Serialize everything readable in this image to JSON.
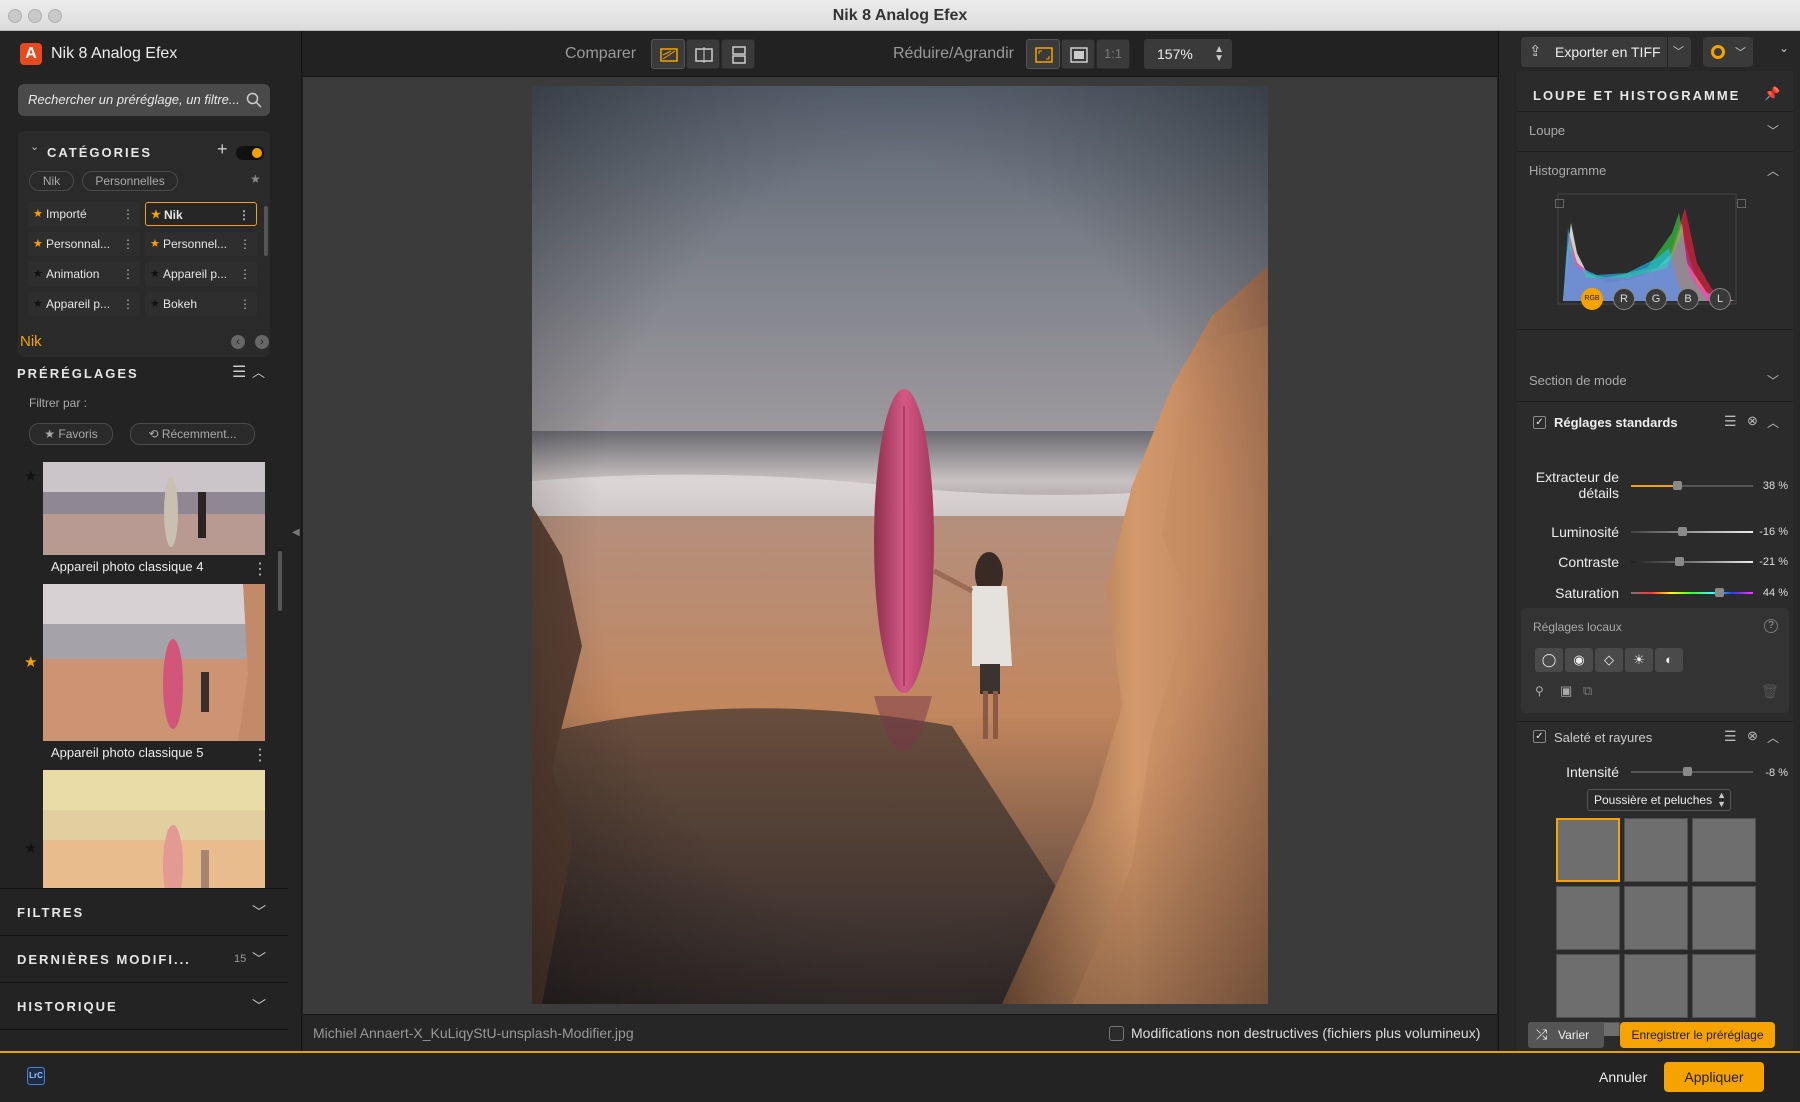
{
  "window": {
    "title": "Nik 8 Analog Efex"
  },
  "left": {
    "app_name": "Nik 8 Analog Efex",
    "app_logo_letter": "A",
    "search_placeholder": "Rechercher un préréglage, un filtre...",
    "categories": {
      "title": "CATÉGORIES",
      "filters": [
        "Nik",
        "Personnelles"
      ],
      "items": [
        {
          "label": "Importé",
          "starred": true,
          "selected": false
        },
        {
          "label": "Nik",
          "starred": true,
          "selected": true
        },
        {
          "label": "Personnal...",
          "starred": true,
          "selected": false
        },
        {
          "label": "Personnel...",
          "starred": true,
          "selected": false
        },
        {
          "label": "Animation",
          "starred": false,
          "selected": false
        },
        {
          "label": "Appareil p...",
          "starred": false,
          "selected": false
        },
        {
          "label": "Appareil p...",
          "starred": false,
          "selected": false
        },
        {
          "label": "Bokeh",
          "starred": false,
          "selected": false
        }
      ]
    },
    "collection_label": "Nik",
    "presets": {
      "title": "PRÉRÉGLAGES",
      "filter_by": "Filtrer par :",
      "filter_favs": "Favoris",
      "filter_recent": "Récemment...",
      "items": [
        {
          "label": "Appareil photo classique 4",
          "favorite": false
        },
        {
          "label": "Appareil photo classique 5",
          "favorite": true
        },
        {
          "label": "",
          "favorite": false
        }
      ]
    },
    "sections": [
      {
        "title": "FILTRES",
        "count": ""
      },
      {
        "title": "DERNIÈRES MODIFI...",
        "count": "15"
      },
      {
        "title": "HISTORIQUE",
        "count": ""
      }
    ]
  },
  "toolbar": {
    "compare_label": "Comparer",
    "zoom_label": "Réduire/Agrandir",
    "one_to_one": "1:1",
    "zoom_value": "157%"
  },
  "status": {
    "filename": "Michiel Annaert-X_KuLiqyStU-unsplash-Modifier.jpg",
    "nondestructive": "Modifications non destructives (fichiers plus volumineux)"
  },
  "right": {
    "export_label": "Exporter en TIFF",
    "loupe_hist_title": "LOUPE ET HISTOGRAMME",
    "loupe": "Loupe",
    "histogram": "Histogramme",
    "channels": [
      "RGB",
      "R",
      "G",
      "B",
      "L"
    ],
    "mode_section": "Section de mode",
    "standard": {
      "title": "Réglages standards",
      "sliders": [
        {
          "label": "Extracteur de détails",
          "value": "38 %",
          "pos": 0.38
        },
        {
          "label": "Luminosité",
          "value": "-16 %",
          "pos": 0.42
        },
        {
          "label": "Contraste",
          "value": "-21 %",
          "pos": 0.39
        },
        {
          "label": "Saturation",
          "value": "44 %",
          "pos": 0.72
        }
      ]
    },
    "local": {
      "title": "Réglages locaux",
      "help": "?"
    },
    "dirt": {
      "title": "Saleté et rayures",
      "intensity_label": "Intensité",
      "intensity_value": "-8 %",
      "intensity_pos": 0.46,
      "type": "Poussière et peluches"
    },
    "vary_label": "Varier",
    "save_preset_label": "Enregistrer le préréglage"
  },
  "bottom": {
    "lrc_badge": "LrC",
    "cancel_label": "Annuler",
    "apply_label": "Appliquer"
  },
  "colors": {
    "accent": "#f6a300",
    "panel": "#232323",
    "canvas": "#3b3b3b"
  }
}
